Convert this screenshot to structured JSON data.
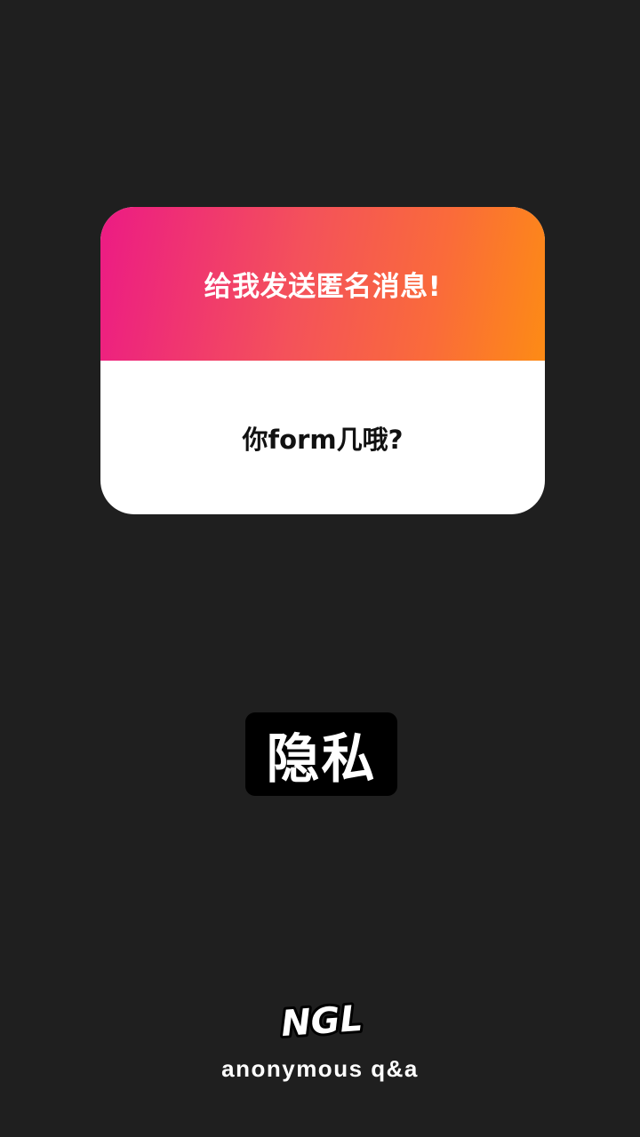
{
  "card": {
    "header_text": "给我发送匿名消息!",
    "question_text": "你form几哦?"
  },
  "badge": {
    "text": "隐私"
  },
  "branding": {
    "logo_text": "NGL",
    "tagline": "anonymous q&a"
  },
  "colors": {
    "background": "#1f1f1f",
    "gradient_start": "#ec1b84",
    "gradient_end": "#fd8b15",
    "card_body": "#ffffff",
    "badge_background": "#000000"
  }
}
